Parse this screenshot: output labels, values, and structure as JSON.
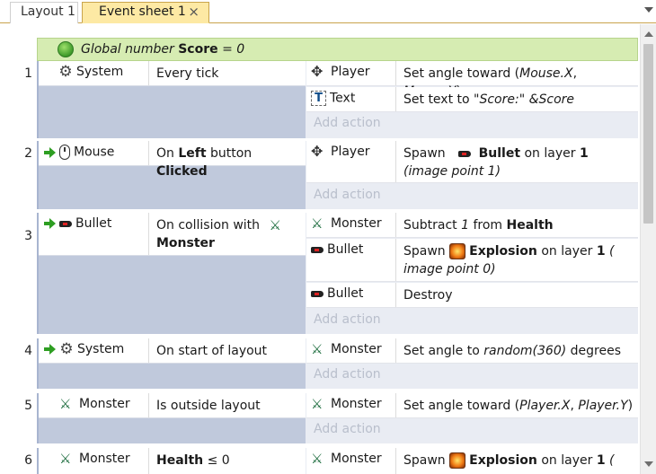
{
  "tabs": [
    {
      "label": "Layout 1",
      "active": false
    },
    {
      "label": "Event sheet 1",
      "active": true,
      "close": "×"
    }
  ],
  "global_var": {
    "prefix": "Global number",
    "name": "Score",
    "suffix": "= 0"
  },
  "events": [
    {
      "number": "1",
      "conditions": [
        {
          "object": "System",
          "icon": "gear-icon",
          "text": "Every tick"
        }
      ],
      "actions": [
        {
          "object": "Player",
          "icon": "player-icon",
          "text": "Set angle toward (Mouse.X, Mouse.Y)"
        },
        {
          "object": "Text",
          "icon": "text-icon",
          "text": "Set text to \"Score:\" &Score"
        }
      ]
    },
    {
      "number": "2",
      "conditions": [
        {
          "object": "Mouse",
          "icon": "mouse-icon",
          "text": "On Left button Clicked"
        }
      ],
      "actions": [
        {
          "object": "Player",
          "icon": "player-icon",
          "text": "Spawn Bullet on layer 1 (image point 1)"
        }
      ]
    },
    {
      "number": "3",
      "conditions": [
        {
          "object": "Bullet",
          "icon": "bullet-icon",
          "text": "On collision with Monster"
        }
      ],
      "actions": [
        {
          "object": "Monster",
          "icon": "monster-icon",
          "text": "Subtract 1 from Health"
        },
        {
          "object": "Bullet",
          "icon": "bullet-icon",
          "text": "Spawn Explosion on layer 1 ( image point 0)"
        },
        {
          "object": "Bullet",
          "icon": "bullet-icon",
          "text": "Destroy"
        }
      ]
    },
    {
      "number": "4",
      "conditions": [
        {
          "object": "System",
          "icon": "gear-icon",
          "text": "On start of layout"
        }
      ],
      "actions": [
        {
          "object": "Monster",
          "icon": "monster-icon",
          "text": "Set angle to random(360) degrees"
        }
      ]
    },
    {
      "number": "5",
      "conditions": [
        {
          "object": "Monster",
          "icon": "monster-icon",
          "text": "Is outside layout"
        }
      ],
      "actions": [
        {
          "object": "Monster",
          "icon": "monster-icon",
          "text": "Set angle toward (Player.X, Player.Y)"
        }
      ]
    },
    {
      "number": "6",
      "conditions": [
        {
          "object": "Monster",
          "icon": "monster-icon",
          "text": "Health ≤ 0"
        }
      ],
      "actions": [
        {
          "object": "Monster",
          "icon": "monster-icon",
          "text": "Spawn Explosion on layer 1 ("
        }
      ]
    }
  ],
  "add_action_label": "Add action"
}
